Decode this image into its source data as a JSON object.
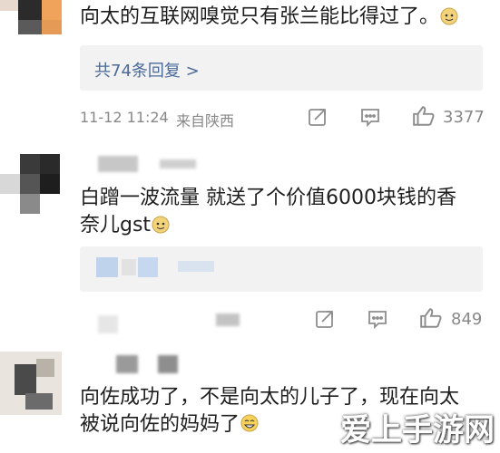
{
  "comments": [
    {
      "text": "向太的互联网嗅觉只有张兰能比得过了。",
      "reply_link": "共74条回复 >",
      "timestamp": "11-12 11:24",
      "location": "来自陕西",
      "like_count": "3377"
    },
    {
      "text_line1": "白蹭一波流量 就送了个价值6000块钱的香",
      "text_line2": "奈儿gst",
      "like_count": "849"
    },
    {
      "text_line1": "向佐成功了，不是向太的儿子了，现在向太",
      "text_line2": "被说向佐的妈妈了"
    }
  ],
  "watermark": "爱上手游网",
  "icons": {
    "share": "share-icon",
    "comment": "comment-icon",
    "like": "thumbs-up-icon",
    "emoji": "emoji-icon"
  },
  "colors": {
    "link": "#4a6a9a",
    "meta": "#888888",
    "reply_bg": "#f2f2f2"
  }
}
